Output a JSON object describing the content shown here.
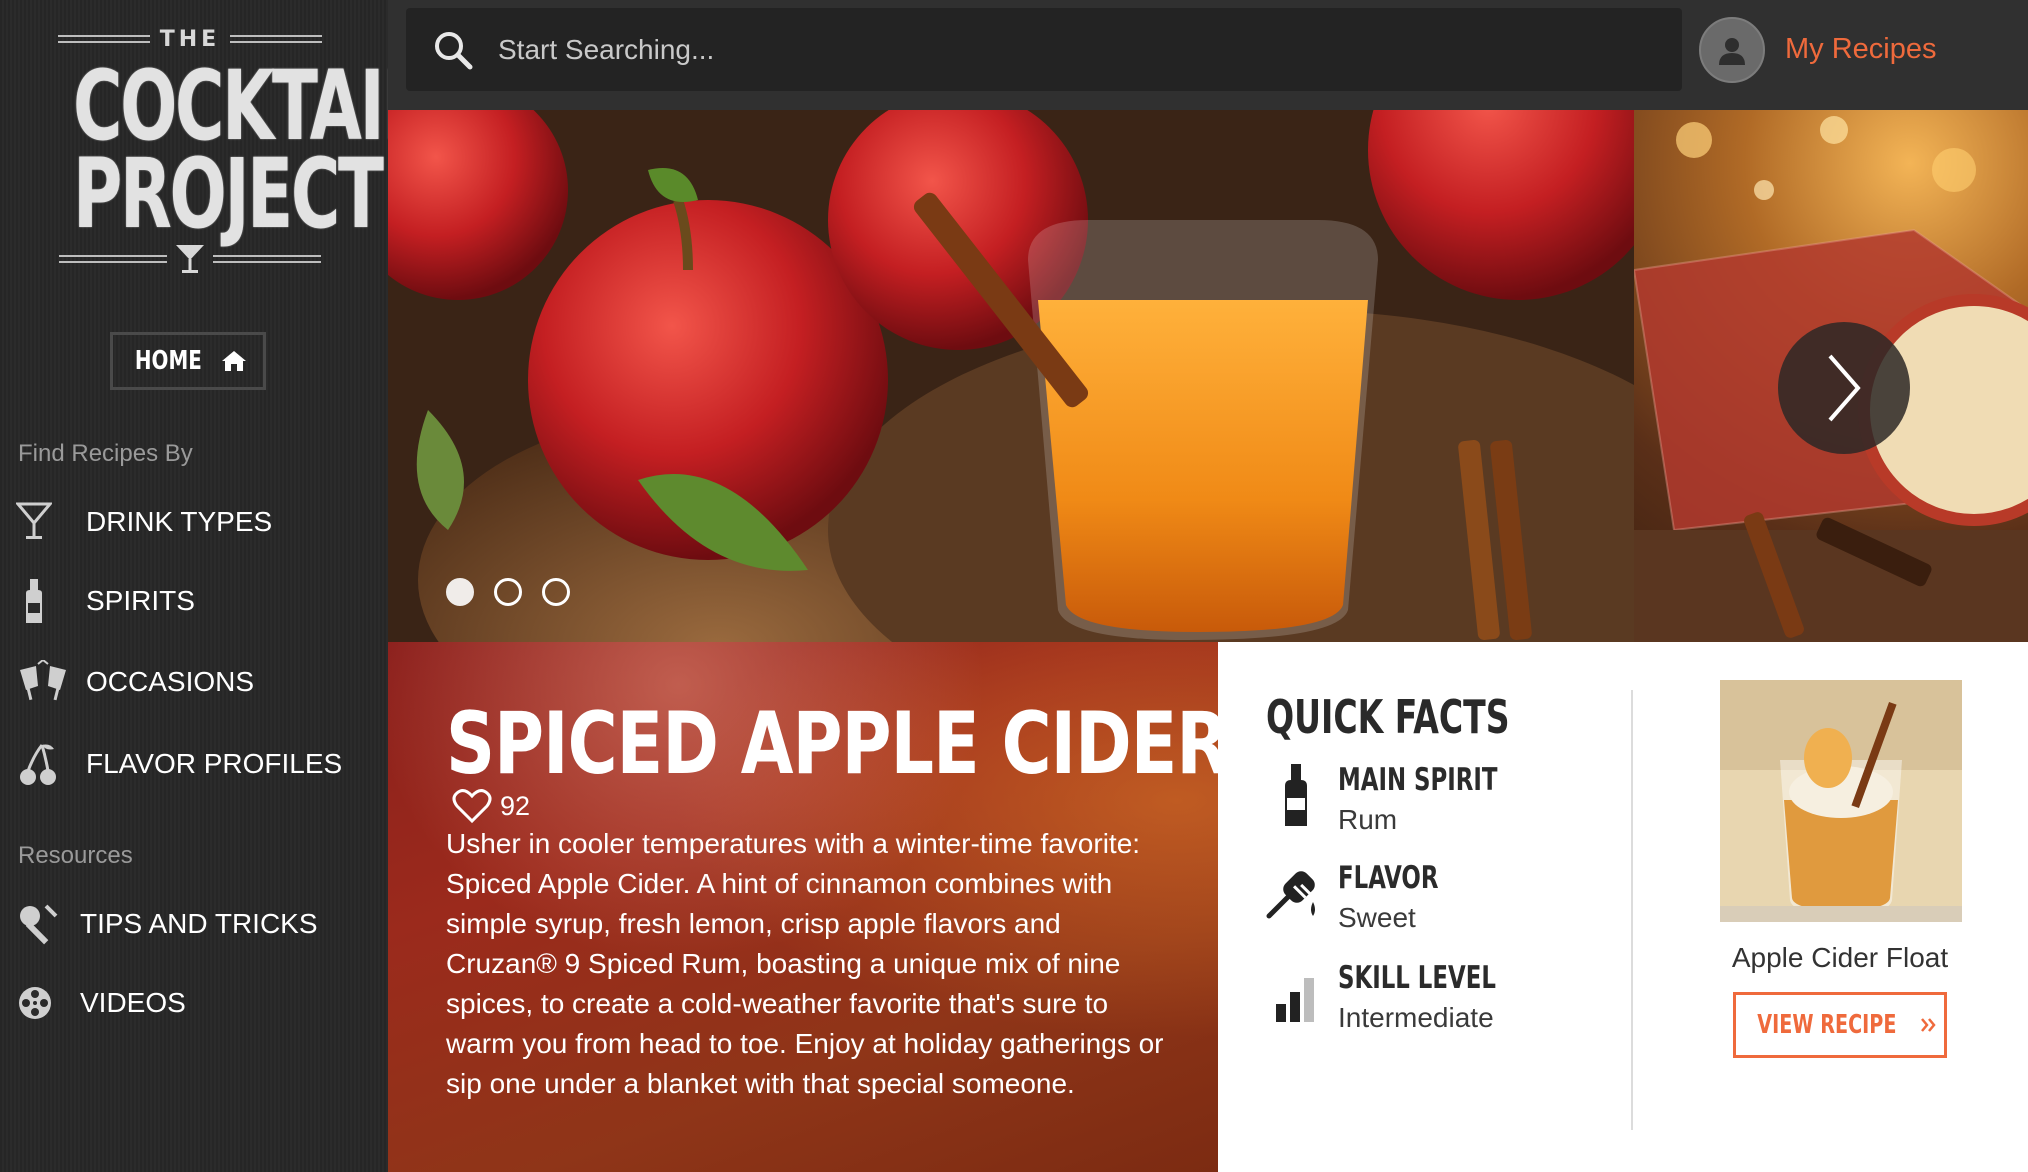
{
  "logo": {
    "the": "THE",
    "line1": "COCKTAIL",
    "line2": "PROJECT"
  },
  "sidebar": {
    "home_label": "HOME",
    "find_heading": "Find Recipes By",
    "find_items": [
      {
        "label": "DRINK TYPES",
        "icon": "martini-glass-icon"
      },
      {
        "label": "SPIRITS",
        "icon": "bottle-icon"
      },
      {
        "label": "OCCASIONS",
        "icon": "cheers-icon"
      },
      {
        "label": "FLAVOR PROFILES",
        "icon": "cherries-icon"
      }
    ],
    "resources_heading": "Resources",
    "resource_items": [
      {
        "label": "TIPS AND TRICKS",
        "icon": "tools-icon"
      },
      {
        "label": "VIDEOS",
        "icon": "film-reel-icon"
      }
    ]
  },
  "header": {
    "search_placeholder": "Start Searching...",
    "my_recipes": "My Recipes"
  },
  "hero": {
    "slides_count": 3,
    "active_slide": 1
  },
  "recipe": {
    "title": "SPICED APPLE CIDER",
    "likes": "92",
    "description": "Usher in cooler temperatures with a winter-time favorite: Spiced Apple Cider. A hint of cinnamon combines with simple syrup, fresh lemon, crisp apple flavors and Cruzan® 9 Spiced Rum, boasting a unique mix of nine spices, to create a cold-weather favorite that's sure to warm you from head to toe. Enjoy at holiday gatherings or sip one under a blanket with that special someone."
  },
  "quick_facts": {
    "title": "QUICK FACTS",
    "items": [
      {
        "label": "MAIN SPIRIT",
        "value": "Rum",
        "icon": "bottle-icon"
      },
      {
        "label": "FLAVOR",
        "value": "Sweet",
        "icon": "honey-dipper-icon"
      },
      {
        "label": "SKILL LEVEL",
        "value": "Intermediate",
        "icon": "bar-level-icon"
      }
    ]
  },
  "related": {
    "name": "Apple Cider Float",
    "button": "VIEW RECIPE"
  },
  "colors": {
    "accent": "#ef6a3c",
    "sidebar": "#282828",
    "topbar": "#303030",
    "recipe_panel": "#8f2a1a"
  }
}
